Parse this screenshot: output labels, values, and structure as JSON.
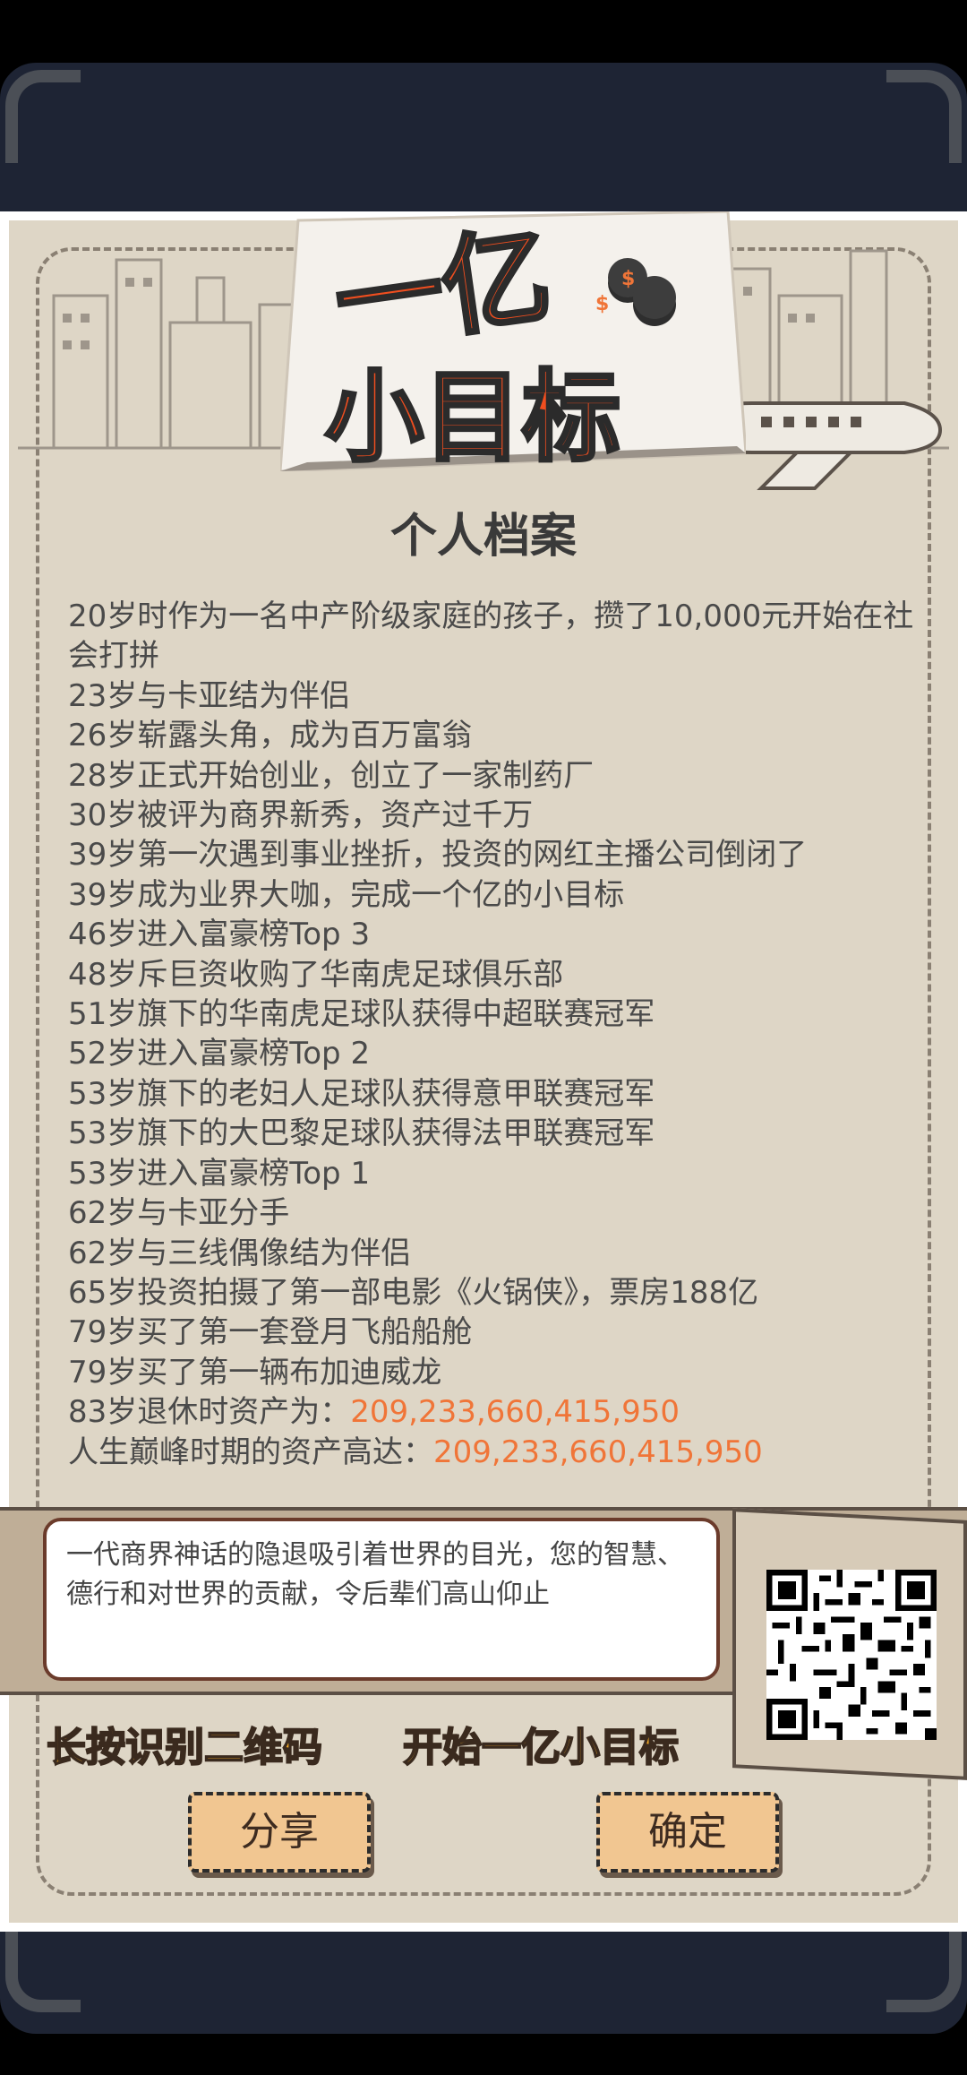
{
  "logo": {
    "top_line": "一亿",
    "bottom_line": "小目标"
  },
  "title": "个人档案",
  "history": [
    "20岁时作为一名中产阶级家庭的孩子，攒了10,000元开始在社会打拼",
    "23岁与卡亚结为伴侣",
    "26岁崭露头角，成为百万富翁",
    "28岁正式开始创业，创立了一家制药厂",
    "30岁被评为商界新秀，资产过千万",
    "39岁第一次遇到事业挫折，投资的网红主播公司倒闭了",
    "39岁成为业界大咖，完成一个亿的小目标",
    "46岁进入富豪榜Top 3",
    "48岁斥巨资收购了华南虎足球俱乐部",
    "51岁旗下的华南虎足球队获得中超联赛冠军",
    "52岁进入富豪榜Top 2",
    "53岁旗下的老妇人足球队获得意甲联赛冠军",
    "53岁旗下的大巴黎足球队获得法甲联赛冠军",
    "53岁进入富豪榜Top 1",
    "62岁与卡亚分手",
    "62岁与三线偶像结为伴侣",
    "65岁投资拍摄了第一部电影《火锅侠》，票房188亿",
    "79岁买了第一套登月飞船船舱",
    "79岁买了第一辆布加迪威龙"
  ],
  "retirement": {
    "label": "83岁退休时资产为：",
    "value": "209,233,660,415,950"
  },
  "peak": {
    "label": "人生巅峰时期的资产高达：",
    "value": "209,233,660,415,950"
  },
  "epitaph": "一代商界神话的隐退吸引着世界的目光，您的智慧、德行和对世界的贡献，令后辈们高山仰止",
  "qr_hint": "长按识别二维码",
  "start_hint": "开始一亿小目标",
  "buttons": {
    "share": "分享",
    "confirm": "确定"
  },
  "colors": {
    "accent_orange": "#f07538",
    "prompt_yellow": "#f3a927",
    "paper": "#ded6c6",
    "frame": "#1e2434"
  }
}
